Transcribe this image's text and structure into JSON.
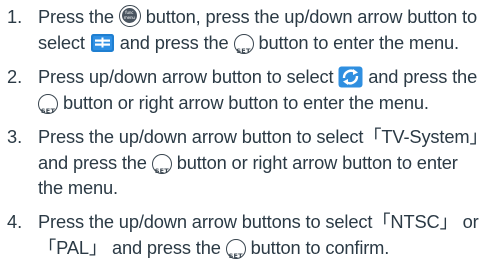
{
  "steps": [
    {
      "number": "1.",
      "line1_a": "Press the",
      "line1_b": "button, press the up/down arrow button to",
      "line2_a": "select",
      "line2_b": "and press the",
      "line2_c": "button to enter the menu."
    },
    {
      "number": "2.",
      "line1_a": "Press up/down arrow button to select",
      "line1_b": "and press the",
      "line2_b": "button or right arrow button to enter the menu."
    },
    {
      "number": "3.",
      "line1": "Press the up/down arrow button to select「TV-System」",
      "line2_a": "and press the",
      "line2_b": "button or right arrow button to enter",
      "line3": "the menu."
    },
    {
      "number": "4.",
      "line1": "Press the up/down arrow buttons to select「NTSC」 or",
      "line2_a": "「PAL」 and press the",
      "line2_b": "button to confirm."
    }
  ],
  "icons": {
    "func_button": "func-menu-button-icon",
    "func_button_label": "func menu",
    "set_button": "set-button-icon",
    "set_button_label": "SET",
    "menu_icon": "playback-menu-icon",
    "setup_icon": "setup-menu-icon"
  },
  "colors": {
    "text": "#2b3a45",
    "menu_icon_blue": "#1f7fd1",
    "setup_icon_blue": "#2f8fe0"
  }
}
